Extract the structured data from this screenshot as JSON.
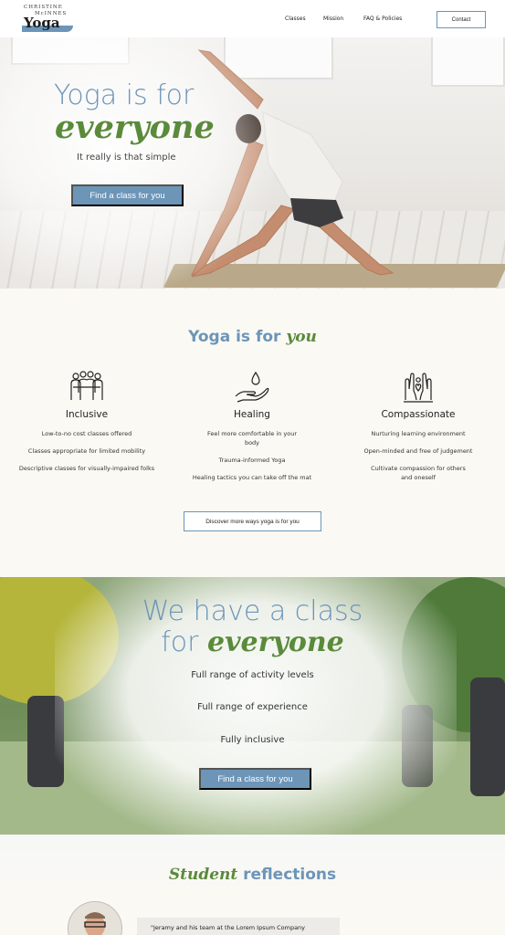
{
  "colors": {
    "accent_blue": "#6c95b8",
    "accent_green": "#5a8a3a",
    "background": "#fbf9f4"
  },
  "logo": {
    "line1": "CHRISTINE",
    "line2": "McINNES",
    "line3": "Yoga"
  },
  "nav": {
    "items": [
      "Classes",
      "Mission",
      "FAQ & Policies"
    ],
    "contact_label": "Contact"
  },
  "hero": {
    "title_line1": "Yoga is for",
    "title_line2": "everyone",
    "subtitle": "It really is that simple",
    "cta_label": "Find a class for you"
  },
  "yoga_for_you": {
    "title_plain": "Yoga is for ",
    "title_em": "you",
    "columns": [
      {
        "icon": "group-people-icon",
        "heading": "Inclusive",
        "items": [
          "Low-to-no cost classes offered",
          "Classes appropriate for limited mobility",
          "Descriptive classes for visually-impaired folks"
        ]
      },
      {
        "icon": "hand-water-drop-icon",
        "heading": "Healing",
        "items": [
          "Feel more comfortable in your body",
          "Trauma-informed Yoga",
          "Healing tactics you can take off the mat"
        ]
      },
      {
        "icon": "hands-heart-icon",
        "heading": "Compassionate",
        "items": [
          "Nurturing learning environment",
          "Open-minded and free of judgement",
          "Cultivate compassion for others and oneself"
        ]
      }
    ],
    "discover_label": "Discover more ways yoga is for you"
  },
  "class_section": {
    "title_line1": "We have a class",
    "title_line2_plain": "for ",
    "title_line2_em": "everyone",
    "lines": [
      "Full range of activity levels",
      "Full range of experience",
      "Fully inclusive"
    ],
    "cta_label": "Find a class for you"
  },
  "reflections": {
    "title_em": "Student",
    "title_plain": " reflections",
    "quote_start": "\"Jeramy and his team at the Lorem Ipsum Company"
  }
}
